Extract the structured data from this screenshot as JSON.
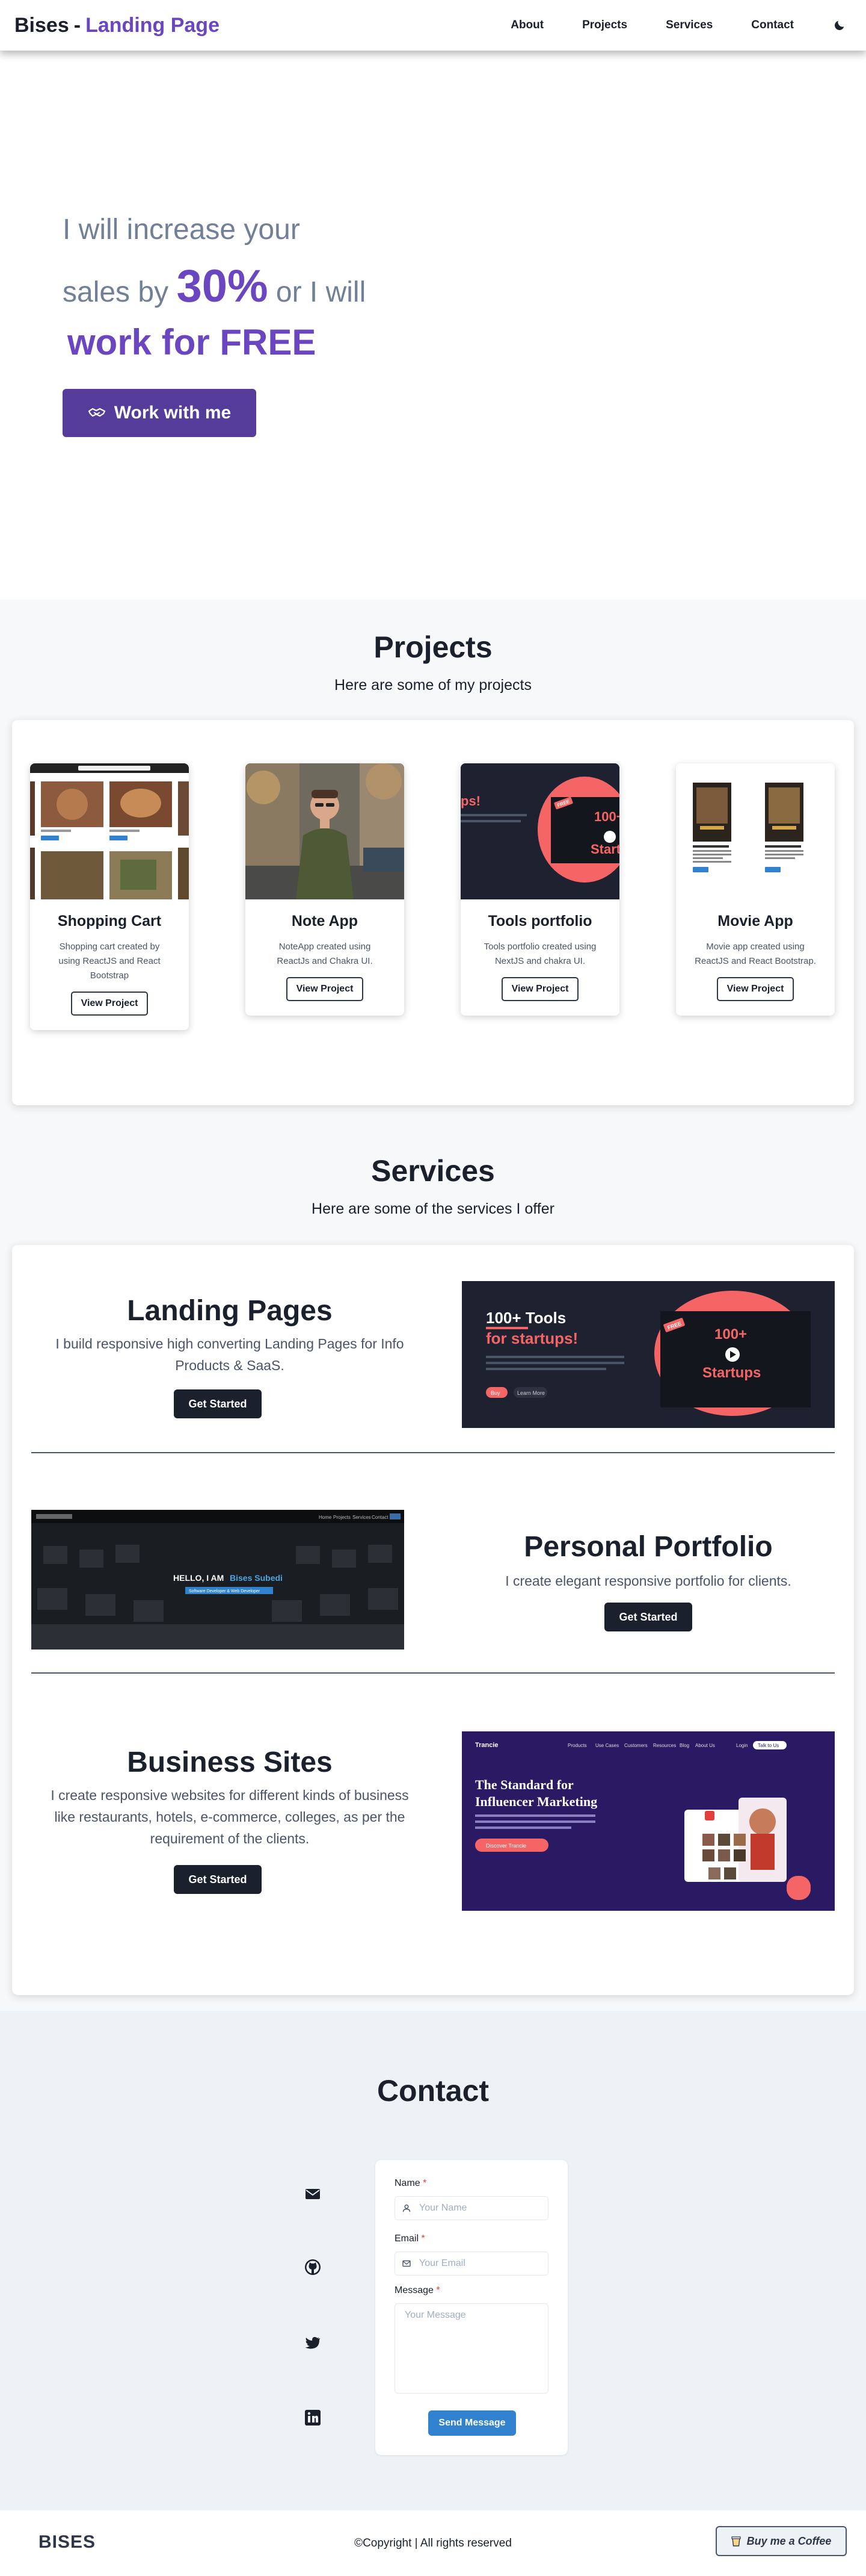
{
  "nav": {
    "brand_prefix": "Bises",
    "brand_sep": "-",
    "brand_accent": "Landing Page",
    "links": [
      "About",
      "Projects",
      "Services",
      "Contact"
    ],
    "theme_icon": "moon-icon"
  },
  "hero": {
    "line1": "I will increase your",
    "line2_pre": "sales by",
    "line2_big": "30%",
    "line2_post": "or I will",
    "line3": "work for FREE",
    "cta_label": "Work with me",
    "cta_icon": "handshake-icon"
  },
  "projects": {
    "title": "Projects",
    "subtitle": "Here are some of my projects",
    "items": [
      {
        "title": "Shopping Cart",
        "desc": "Shopping cart created by using ReactJS and React Bootstrap",
        "button": "View Project"
      },
      {
        "title": "Note App",
        "desc": "NoteApp created using ReactJs and Chakra UI.",
        "button": "View Project"
      },
      {
        "title": "Tools portfolio",
        "desc": "Tools portfolio created using NextJS and chakra UI.",
        "button": "View Project"
      },
      {
        "title": "Movie App",
        "desc": "Movie app created using ReactJS and React Bootstrap.",
        "button": "View Project"
      }
    ],
    "thumb_texts": {
      "tools_badge": "FREE",
      "tools_big": "100+",
      "tools_word": "Startups",
      "tools_left": "ps!"
    }
  },
  "services": {
    "title": "Services",
    "subtitle": "Here are some of the services I offer",
    "items": [
      {
        "title": "Landing Pages",
        "desc": "I build responsive high converting Landing Pages for Info Products & SaaS.",
        "button": "Get Started"
      },
      {
        "title": "Personal Portfolio",
        "desc": "I create elegant responsive portfolio for clients.",
        "button": "Get Started"
      },
      {
        "title": "Business Sites",
        "desc": "I create responsive websites for different kinds of business like restaurants, hotels, e-commerce, colleges, as per the requirement of the clients.",
        "button": "Get Started"
      }
    ],
    "landing_img": {
      "headline1": "100+ Tools",
      "headline2": "for startups!",
      "badge": "FREE",
      "big": "100+",
      "word": "Startups",
      "btn1": "Buy",
      "btn2": "Learn More"
    },
    "portfolio_img": {
      "hello": "HELLO, I AM",
      "name": "Bises Subedi",
      "tagline": "Software Developer & Web Developer",
      "menu": [
        "Home",
        "Projects",
        "Services",
        "Contact",
        "Me"
      ]
    },
    "business_img": {
      "logo": "Trancie",
      "headline1": "The Standard for",
      "headline2": "Influencer Marketing",
      "cta": "Discover Trancie",
      "menu": [
        "Products",
        "Use Cases",
        "Customers",
        "Resources",
        "Blog",
        "About Us",
        "Login",
        "Talk to Us"
      ]
    }
  },
  "contact": {
    "title": "Contact",
    "icons": [
      "mail-icon",
      "github-icon",
      "twitter-icon",
      "linkedin-icon"
    ],
    "name_label": "Name",
    "name_placeholder": "Your Name",
    "email_label": "Email",
    "email_placeholder": "Your Email",
    "message_label": "Message",
    "message_placeholder": "Your Message",
    "required_mark": "*",
    "send_label": "Send Message"
  },
  "footer": {
    "logo": "BISES",
    "copyright": "©Copyright | All rights reserved",
    "coffee_label": "Buy me a Coffee",
    "coffee_icon": "coffee-cup-icon"
  },
  "colors": {
    "accent": "#6b46c1",
    "cta_bg": "#553c9a",
    "dark": "#1a202c",
    "send": "#3182ce"
  }
}
